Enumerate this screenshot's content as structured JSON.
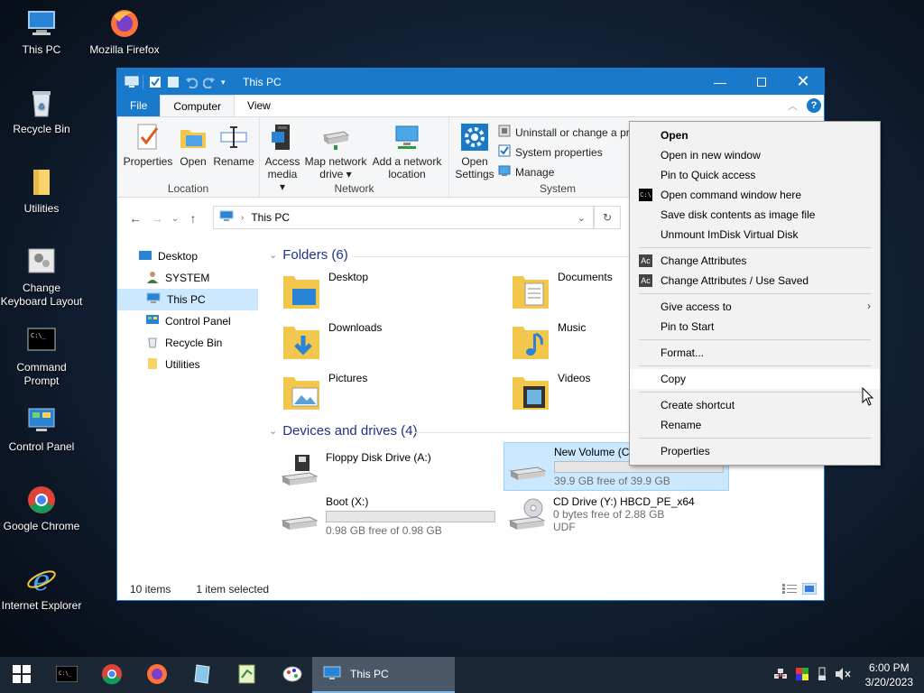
{
  "desktop": {
    "icons": [
      {
        "label": "This PC"
      },
      {
        "label": "Mozilla Firefox"
      },
      {
        "label": "Recycle Bin"
      },
      {
        "label": "Utilities"
      },
      {
        "label": "Change Keyboard Layout"
      },
      {
        "label": "Command Prompt"
      },
      {
        "label": "Control Panel"
      },
      {
        "label": "Google Chrome"
      },
      {
        "label": "Internet Explorer"
      }
    ]
  },
  "window": {
    "title": "This PC",
    "tabs": {
      "file": "File",
      "computer": "Computer",
      "view": "View"
    },
    "ribbon": {
      "location": {
        "name": "Location",
        "properties": "Properties",
        "open": "Open",
        "rename": "Rename"
      },
      "network": {
        "name": "Network",
        "access_media_1": "Access",
        "access_media_2": "media",
        "map_drive_1": "Map network",
        "map_drive_2": "drive",
        "add_location_1": "Add a network",
        "add_location_2": "location"
      },
      "system": {
        "name": "System",
        "open_settings_1": "Open",
        "open_settings_2": "Settings",
        "uninstall": "Uninstall or change a pr",
        "system_properties": "System properties",
        "manage": "Manage"
      }
    },
    "address": {
      "path": "This PC"
    },
    "nav": {
      "items": [
        {
          "label": "Desktop"
        },
        {
          "label": "SYSTEM"
        },
        {
          "label": "This PC"
        },
        {
          "label": "Control Panel"
        },
        {
          "label": "Recycle Bin"
        },
        {
          "label": "Utilities"
        }
      ]
    },
    "folders": {
      "header": "Folders (6)",
      "items": [
        {
          "label": "Desktop"
        },
        {
          "label": "Documents"
        },
        {
          "label": "Downloads"
        },
        {
          "label": "Music"
        },
        {
          "label": "Pictures"
        },
        {
          "label": "Videos"
        }
      ]
    },
    "drives": {
      "header": "Devices and drives (4)",
      "items": [
        {
          "label": "Floppy Disk Drive (A:)",
          "info": ""
        },
        {
          "label": "New Volume (C",
          "info": "39.9 GB free of 39.9 GB",
          "used_fraction": 0.0
        },
        {
          "label": "Boot (X:)",
          "info": "0.98 GB free of 0.98 GB",
          "used_fraction": 0.0
        },
        {
          "label": "CD Drive (Y:) HBCD_PE_x64",
          "info": "0 bytes free of 2.88 GB",
          "info2": "UDF"
        }
      ]
    },
    "status": {
      "items": "10 items",
      "selected": "1 item selected"
    }
  },
  "context_menu": {
    "items": [
      {
        "label": "Open"
      },
      {
        "label": "Open in new window"
      },
      {
        "label": "Pin to Quick access"
      },
      {
        "label": "Open command window here"
      },
      {
        "label": "Save disk contents as image file"
      },
      {
        "label": "Unmount ImDisk Virtual Disk"
      },
      {
        "label": "Change Attributes"
      },
      {
        "label": "Change Attributes / Use Saved"
      },
      {
        "label": "Give access to"
      },
      {
        "label": "Pin to Start"
      },
      {
        "label": "Format..."
      },
      {
        "label": "Copy"
      },
      {
        "label": "Create shortcut"
      },
      {
        "label": "Rename"
      },
      {
        "label": "Properties"
      }
    ],
    "icon_text": "Ac",
    "cmd_icon_text": "C:\\"
  },
  "taskbar": {
    "active_window": "This PC",
    "time": "6:00 PM",
    "date": "3/20/2023"
  },
  "colors": {
    "accent": "#1979ca",
    "selection": "#cce8ff",
    "header_blue": "#1e3287",
    "taskbar": "#1b2735"
  }
}
